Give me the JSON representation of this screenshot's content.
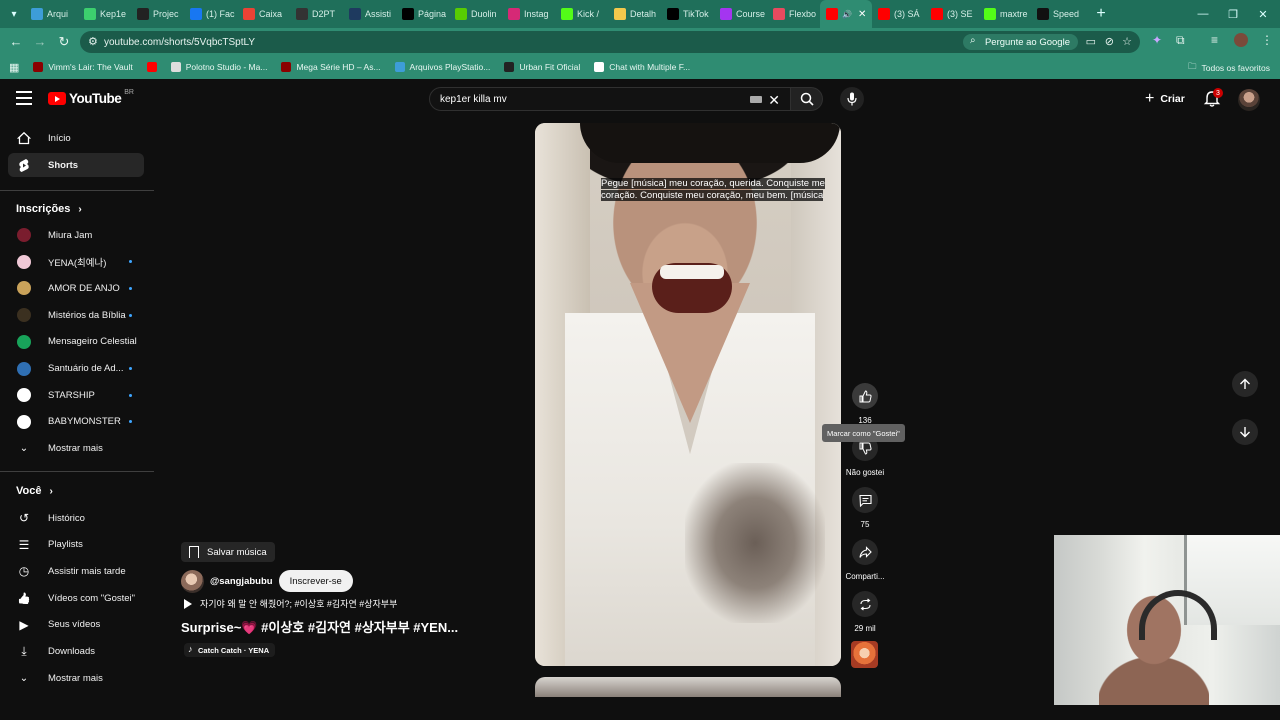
{
  "browser": {
    "tabs": [
      {
        "label": "Arqui",
        "color": "#3d9dd8"
      },
      {
        "label": "Kep1e",
        "color": "#3ccf6e"
      },
      {
        "label": "Projec",
        "color": "#222222"
      },
      {
        "label": "(1) Fac",
        "color": "#1877f2"
      },
      {
        "label": "Caixa",
        "color": "#ea4335"
      },
      {
        "label": "D2PT",
        "color": "#333333"
      },
      {
        "label": "Assisti",
        "color": "#1e3a5f"
      },
      {
        "label": "Página",
        "color": "#000000"
      },
      {
        "label": "Duolin",
        "color": "#58cc02"
      },
      {
        "label": "Instag",
        "color": "#d62976"
      },
      {
        "label": "Kick /",
        "color": "#53fc18"
      },
      {
        "label": "Detalh",
        "color": "#f2c94c"
      },
      {
        "label": "TikTok",
        "color": "#000000"
      },
      {
        "label": "Course",
        "color": "#a435f0"
      },
      {
        "label": "Flexbo",
        "color": "#e84a5f"
      },
      {
        "label": "",
        "color": "#ff0000"
      },
      {
        "label": "(3) SÁ",
        "color": "#ff0000"
      },
      {
        "label": "(3) SE",
        "color": "#ff0000"
      },
      {
        "label": "maxtre",
        "color": "#53fc18"
      },
      {
        "label": "Speed",
        "color": "#111111"
      }
    ],
    "url": "youtube.com/shorts/5VqbcTSptLY",
    "ask_google": "Pergunte ao Google",
    "bookmarks": [
      {
        "label": "Vimm's Lair: The Vault",
        "color": "#8b0000"
      },
      {
        "label": "",
        "color": "#ff0000"
      },
      {
        "label": "Polotno Studio - Ma...",
        "color": "#dddddd"
      },
      {
        "label": "Mega Série HD – As...",
        "color": "#8b0000"
      },
      {
        "label": "Arquivos PlayStatio...",
        "color": "#3d9dd8"
      },
      {
        "label": "Urban Fit Oficial",
        "color": "#222222"
      },
      {
        "label": "Chat with Multiple F...",
        "color": "#ffffff"
      }
    ],
    "all_favorites": "Todos os favoritos"
  },
  "youtube": {
    "logo_text": "YouTube",
    "country": "BR",
    "search_value": "kep1er killa mv",
    "create_label": "Criar",
    "notification_count": "3",
    "sidebar": {
      "main": [
        {
          "label": "Início",
          "icon": "home-icon"
        },
        {
          "label": "Shorts",
          "icon": "shorts-icon"
        }
      ],
      "subs_header": "Inscrições",
      "subscriptions": [
        {
          "label": "Miura Jam",
          "color": "#7a1d2e",
          "dot": false
        },
        {
          "label": "YENA(최예나)",
          "color": "#f0c8d6",
          "dot": true
        },
        {
          "label": "AMOR DE ANJO",
          "color": "#c9a25a",
          "dot": true
        },
        {
          "label": "Mistérios da Bíblia",
          "color": "#3b3020",
          "dot": true
        },
        {
          "label": "Mensageiro Celestial",
          "color": "#18a35a",
          "dot": false
        },
        {
          "label": "Santuário de Ad...",
          "color": "#2f6fb3",
          "dot": true
        },
        {
          "label": "STARSHIP",
          "color": "#ffffff",
          "dot": true
        },
        {
          "label": "BABYMONSTER",
          "color": "#ffffff",
          "dot": true
        }
      ],
      "show_more": "Mostrar mais",
      "you_header": "Você",
      "you_items": [
        {
          "label": "Histórico",
          "icon": "history-icon"
        },
        {
          "label": "Playlists",
          "icon": "playlists-icon"
        },
        {
          "label": "Assistir mais tarde",
          "icon": "watch-later-icon"
        },
        {
          "label": "Vídeos com \"Gostei\"",
          "icon": "liked-icon"
        },
        {
          "label": "Seus vídeos",
          "icon": "your-videos-icon"
        },
        {
          "label": "Downloads",
          "icon": "downloads-icon"
        }
      ],
      "show_more_2": "Mostrar mais"
    },
    "short": {
      "caption_line1": "Pegue [música] meu coração, querida.  Conquiste me",
      "caption_line2": "coração.  Conquiste meu coração, meu bem.  [música",
      "save_music": "Salvar música",
      "channel": "@sangjabubu",
      "subscribe": "Inscrever-se",
      "description": "자기야 왜 말 안 해줬어?; #이상호 #김자연 #상자부부",
      "title_part1": "Surprise~",
      "title_heart": "💗",
      "title_part2": "#이상호 #김자연 #상자부부 #YEN...",
      "music": "Catch Catch · YENA"
    },
    "actions": {
      "like_count": "136",
      "like_tooltip": "Marcar como \"Gostei\"",
      "dislike_label": "Não gostei",
      "comments_count": "75",
      "share_label": "Comparti...",
      "remix_count": "29 mil"
    }
  }
}
